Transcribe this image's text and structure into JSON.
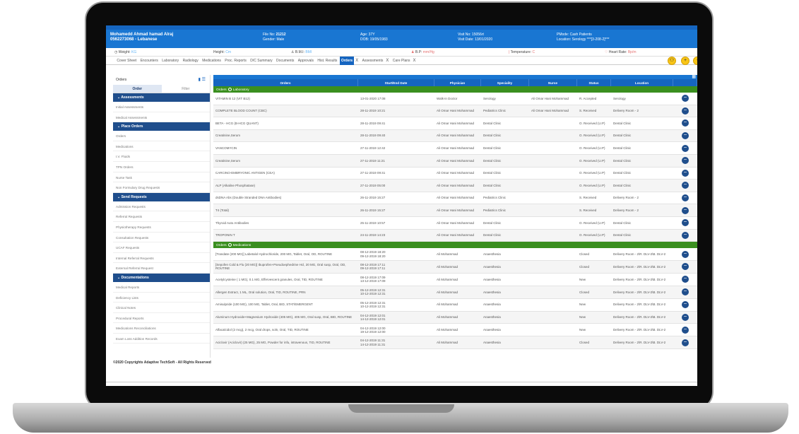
{
  "patient": {
    "name": "Mohamedd Ahmad hamad Alraj",
    "phone_nationality": "0562273068 - Lebanese",
    "file_no_label": "File No:",
    "file_no": "21212",
    "gender": "Gender: Male",
    "age": "Age: 37Y",
    "dob": "DOB: 19/05/1983",
    "visit_no": "Visit No: 15056rt",
    "visit_date": "Visit Date: 13/01/2020",
    "pmode": "PMode: Cash Patients",
    "location": "Location: Serology ***[3-208-2]***"
  },
  "vitals": {
    "weight_label": "Weight:",
    "weight": "KG",
    "height_label": "Height:",
    "height": "Cm",
    "bmi_label": "B.M.I:",
    "bmi": "BMI",
    "bp_label": "B.P:",
    "bp": "mm/Hg",
    "temp_label": "Temperature:",
    "temp": "C",
    "hr_label": "Heart Rate:",
    "hr": "Bp/m"
  },
  "tabs": [
    {
      "label": "Cover Sheet"
    },
    {
      "label": "Encounters"
    },
    {
      "label": "Laboratory"
    },
    {
      "label": "Radiology"
    },
    {
      "label": "Medications"
    },
    {
      "label": "Proc. Reports"
    },
    {
      "label": "D/C Summary"
    },
    {
      "label": "Documents"
    },
    {
      "label": "Approvals"
    },
    {
      "label": "Hist. Results"
    },
    {
      "label": "Orders"
    },
    {
      "label": "Assessments"
    },
    {
      "label": "Care Plans"
    }
  ],
  "tab_close_glyph": "X",
  "sidebar": {
    "title": "Orders",
    "tab_order": "Order",
    "tab_filter": "Filter",
    "sections": [
      {
        "label": "Assessments",
        "items": [
          "Initial Assessments",
          "Medical Assessments"
        ]
      },
      {
        "label": "Place Orders",
        "items": [
          "Orders",
          "Medications",
          "I.V. Fluids",
          "TPN Orders",
          "Nurse Task",
          "Non Formulary Drug Requests"
        ]
      },
      {
        "label": "Send Requests",
        "items": [
          "Admission Requests",
          "Referral Requests",
          "Physiotherapy Requests",
          "Consultation Requests",
          "UCAF Requests",
          "Internal Referral Requests",
          "External Referral Request"
        ]
      },
      {
        "label": "Documentations",
        "items": [
          "Medical Reports",
          "Deficiency Lists",
          "Clinical Notes",
          "Procedural Reports",
          "Medications Reconciliations",
          "Exam Loss Addition Records"
        ]
      }
    ]
  },
  "grid": {
    "headers": [
      "Orders",
      "Start/End Date",
      "Physician",
      "Speciality",
      "Nurse",
      "Status",
      "Location"
    ],
    "group_orders_label": "Orders",
    "group_lab": "Laboratory",
    "group_med": "Medications",
    "lab_rows": [
      {
        "order": "VITAMIN B 12 (VIT B12)",
        "date": "13-01-2020 17:08",
        "phys": "Walk-in Doctor",
        "spec": "Serology",
        "nurse": "Ali Omar Hani Mohammad",
        "status": "R. Accepted",
        "loc": "Serology"
      },
      {
        "order": "COMPLETE BLOOD COUNT (CBC)",
        "date": "28-11-2019 10:21",
        "phys": "Ali Omar Hani Mohammad",
        "spec": "Pediatrics Clinic",
        "nurse": "Ali Omar Hani Mohammad",
        "status": "S. Received",
        "loc": "Delivery Room - 2"
      },
      {
        "order": "BETA - HCG (B-HCG QUANT)",
        "date": "28-11-2019 09:41",
        "phys": "Ali Omar Hani Mohammad",
        "spec": "Dental Clinic",
        "nurse": "",
        "status": "O. Received (U.P)",
        "loc": "Dental Clinic"
      },
      {
        "order": "Creatinine,Serum",
        "date": "28-11-2019 09:40",
        "phys": "Ali Omar Hani Mohammad",
        "spec": "Dental Clinic",
        "nurse": "",
        "status": "O. Received (U.P)",
        "loc": "Dental Clinic"
      },
      {
        "order": "VANCOMYCIN",
        "date": "27-11-2019 12:42",
        "phys": "Ali Omar Hani Mohammad",
        "spec": "Dental Clinic",
        "nurse": "",
        "status": "O. Received (U.P)",
        "loc": "Dental Clinic"
      },
      {
        "order": "Creatinine,Serum",
        "date": "27-11-2019 11:21",
        "phys": "Ali Omar Hani Mohammad",
        "spec": "Dental Clinic",
        "nurse": "",
        "status": "O. Received (U.P)",
        "loc": "Dental Clinic"
      },
      {
        "order": "CARCINO-EMBRYONIC ANTIGEN (CEA)",
        "date": "27-11-2019 09:41",
        "phys": "Ali Omar Hani Mohammad",
        "spec": "Dental Clinic",
        "nurse": "",
        "status": "O. Received (U.P)",
        "loc": "Dental Clinic"
      },
      {
        "order": "ALP (Alkaline Phosphatase)",
        "date": "27-11-2019 05:00",
        "phys": "Ali Omar Hani Mohammad",
        "spec": "Dental Clinic",
        "nurse": "",
        "status": "O. Received (U.P)",
        "loc": "Dental Clinic"
      },
      {
        "order": "dsDNA Abs (Double Stranded DNA Antibodies)",
        "date": "26-11-2019 15:27",
        "phys": "Ali Omar Hani Mohammad",
        "spec": "Pediatrics Clinic",
        "nurse": "",
        "status": "S. Received",
        "loc": "Delivery Room - 2"
      },
      {
        "order": "T4 (Total)",
        "date": "26-11-2019 15:27",
        "phys": "Ali Omar Hani Mohammad",
        "spec": "Pediatrics Clinic",
        "nurse": "",
        "status": "S. Received",
        "loc": "Delivery Room - 2"
      },
      {
        "order": "Thyroid Auto Antibodies",
        "date": "25-11-2019 10:57",
        "phys": "Ali Omar Hani Mohammad",
        "spec": "Dental Clinic",
        "nurse": "",
        "status": "O. Received (U.P)",
        "loc": "Dental Clinic"
      },
      {
        "order": "TROPONIN T",
        "date": "24-11-2019 14:23",
        "phys": "Ali Omar Hani Mohammad",
        "spec": "Dental Clinic",
        "nurse": "",
        "status": "O. Received (U.P)",
        "loc": "Dental Clinic"
      }
    ],
    "med_rows": [
      {
        "order": "[Trandate (200 MG)] Labetalol Hydrochloride, 200 MG, Tablet, Oral, OD, ROUTINE",
        "date": "08-12-2019 18:20\n09-12-2019 18:20",
        "phys": "Ali Mohammad",
        "spec": "Anaesthesia",
        "nurse": "",
        "status": "Closed",
        "loc": "Delivery Room - 2\\R. DLV-2\\B. DLV-2"
      },
      {
        "order": "[Sepofen Cold & Flu (20 MG)] Ibuprofen+Pseudoephedrine Hcl, 20 MG, Oral susp, Oral, OD, ROUTINE",
        "date": "08-12-2019 17:11\n09-12-2019 17:11",
        "phys": "Ali Mohammad",
        "spec": "Anaesthesia",
        "nurse": "",
        "status": "Closed",
        "loc": "Delivery Room - 2\\R. DLV-2\\B. DLV-2"
      },
      {
        "order": "Acetylcysteine ( 1 MG), 0.1 MG, Effervescent granules, Oral, TID, ROUTINE",
        "date": "08-12-2019 17:09\n13-12-2019 17:09",
        "phys": "Ali Mohammad",
        "spec": "Anaesthesia",
        "nurse": "",
        "status": "New",
        "loc": "Delivery Room - 2\\R. DLV-2\\B. DLV-2"
      },
      {
        "order": "Allergen Extract, 1 ML, Oral solution, Oral, TID, ROUTINE, PRN",
        "date": "05-12-2019 12:31\n10-12-2019 12:31",
        "phys": "Ali Mohammad",
        "spec": "Anaesthesia",
        "nurse": "",
        "status": "Closed",
        "loc": "Delivery Room - 2\\R. DLV-2\\B. DLV-2"
      },
      {
        "order": "Amisulpride (100 MG), 100 MG, Tablet, Oral, BID, STAT/EMERGENT",
        "date": "05-12-2019 12:31\n10-12-2019 12:31",
        "phys": "Ali Mohammad",
        "spec": "Anaesthesia",
        "nurse": "",
        "status": "New",
        "loc": "Delivery Room - 2\\R. DLV-2\\B. DLV-2"
      },
      {
        "order": "Aluminum Hydroxide+Magnesium Hydroxide (405 MG), 405 MG, Oral susp, Oral, BID, ROUTINE",
        "date": "04-12-2019 12:01\n14-12-2019 12:01",
        "phys": "Ali Mohammad",
        "spec": "Anaesthesia",
        "nurse": "",
        "status": "New",
        "loc": "Delivery Room - 2\\R. DLV-2\\B. DLV-2"
      },
      {
        "order": "Alfacalcidol (2 mcg), 2 mcg, Oral drops, soln, Oral, TID, ROUTINE",
        "date": "04-12-2019 12:00\n19-12-2019 12:00",
        "phys": "Ali Mohammad",
        "spec": "Anaesthesia",
        "nurse": "",
        "status": "New",
        "loc": "Delivery Room - 2\\R. DLV-2\\B. DLV-2"
      },
      {
        "order": "Aciclovir (Aciclovir) (25 MG), 25 MG, Powder for infu, intravenous, TID, ROUTINE",
        "date": "04-12-2019 11:31\n14-12-2019 11:31",
        "phys": "Ali Mohammad",
        "spec": "Anaesthesia",
        "nurse": "",
        "status": "Closed",
        "loc": "Delivery Room - 2\\R. DLV-2\\B. DLV-2"
      }
    ]
  },
  "footer": "©2020 Copyrights Adaptive TechSoft - All Rights Reserved",
  "icons": {
    "action": "chevron-circle-icon",
    "menu": "menu-icon",
    "add": "plus-icon",
    "collapse": "minus-icon"
  },
  "colors": {
    "header_blue": "#1976d2",
    "section_navy": "#1f4e8c",
    "group_green": "#3a8f1f",
    "accent_yellow": "#f9c516"
  }
}
